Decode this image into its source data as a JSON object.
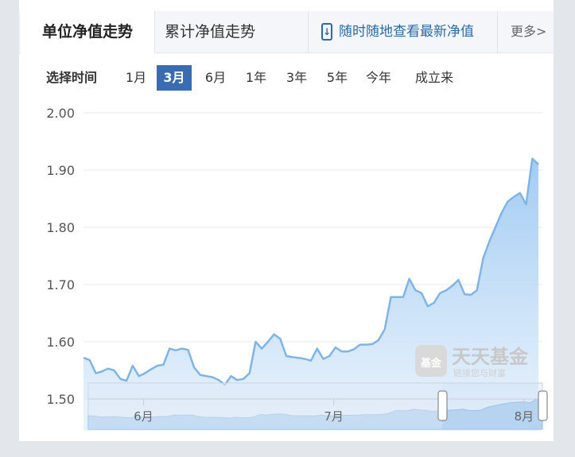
{
  "tabs": {
    "nav_title": "单位净值走势",
    "acc_title": "累计净值走势",
    "mobile_link": "随时随地查看最新净值",
    "more": "更多>"
  },
  "range": {
    "label": "选择时间",
    "options": [
      "1月",
      "3月",
      "6月",
      "1年",
      "3年",
      "5年",
      "今年",
      "成立来"
    ],
    "selected": "3月"
  },
  "watermark": {
    "logo_text": "基金",
    "brand": "天天基金",
    "slogan": "链接您与财富"
  },
  "chart_data": {
    "type": "area",
    "x_tick_labels": [
      "6月",
      "7月",
      "8月"
    ],
    "x_tick_positions": [
      9,
      40,
      71
    ],
    "ylim": [
      1.5,
      2.0
    ],
    "yticks": [
      "2.00",
      "1.90",
      "1.80",
      "1.70",
      "1.60",
      "1.50"
    ],
    "ytick_values": [
      2.0,
      1.9,
      1.8,
      1.7,
      1.6,
      1.5
    ],
    "grid": true,
    "colors": {
      "line": "#7fb5e6",
      "fill_top": "#9ec9f2",
      "fill_bottom": "#e8f2fc",
      "grid": "#e6e9f0"
    },
    "series": [
      {
        "values": [
          1.572,
          1.568,
          1.545,
          1.548,
          1.553,
          1.55,
          1.535,
          1.532,
          1.558,
          1.54,
          1.545,
          1.552,
          1.558,
          1.56,
          1.588,
          1.585,
          1.588,
          1.586,
          1.555,
          1.542,
          1.54,
          1.538,
          1.533,
          1.525,
          1.54,
          1.533,
          1.535,
          1.545,
          1.6,
          1.588,
          1.6,
          1.613,
          1.605,
          1.575,
          1.573,
          1.572,
          1.57,
          1.567,
          1.588,
          1.57,
          1.575,
          1.59,
          1.583,
          1.583,
          1.587,
          1.595,
          1.595,
          1.596,
          1.603,
          1.622,
          1.678,
          1.678,
          1.678,
          1.71,
          1.69,
          1.685,
          1.662,
          1.668,
          1.685,
          1.69,
          1.698,
          1.708,
          1.683,
          1.682,
          1.69,
          1.745,
          1.775,
          1.8,
          1.825,
          1.845,
          1.853,
          1.86,
          1.84,
          1.92,
          1.91
        ]
      }
    ]
  }
}
